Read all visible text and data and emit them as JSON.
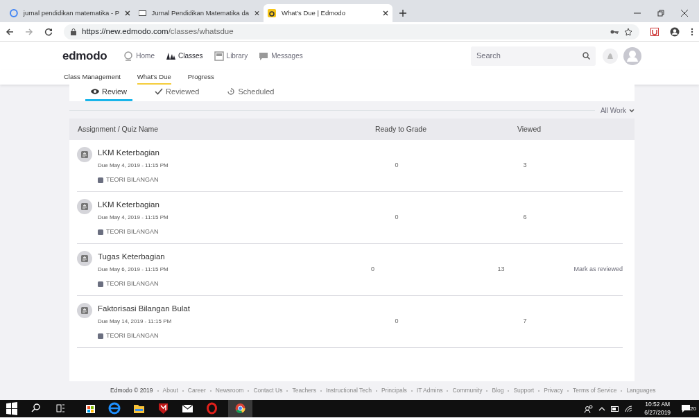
{
  "browser": {
    "tabs": [
      {
        "title": "jurnal pendidikan matematika - P",
        "selected": false
      },
      {
        "title": "Jurnal Pendidikan Matematika da",
        "selected": false
      },
      {
        "title": "What's Due | Edmodo",
        "selected": true
      }
    ],
    "url_host": "https://new.edmodo.com",
    "url_path": "/classes/whatsdue"
  },
  "nav": {
    "logo": "edmodo",
    "items": [
      {
        "label": "Home",
        "selected": false
      },
      {
        "label": "Classes",
        "selected": true
      },
      {
        "label": "Library",
        "selected": false
      },
      {
        "label": "Messages",
        "selected": false
      }
    ],
    "search_placeholder": "Search"
  },
  "subnav": [
    {
      "label": "Class Management",
      "selected": false
    },
    {
      "label": "What's Due",
      "selected": true
    },
    {
      "label": "Progress",
      "selected": false
    }
  ],
  "tabs": [
    {
      "label": "Review",
      "selected": true
    },
    {
      "label": "Reviewed",
      "selected": false
    },
    {
      "label": "Scheduled",
      "selected": false
    }
  ],
  "filter": "All Work",
  "table": {
    "columns": [
      "Assignment / Quiz Name",
      "Ready to Grade",
      "Viewed"
    ],
    "rows": [
      {
        "title": "LKM Keterbagian",
        "due": "Due May 4, 2019 - 11:15 PM",
        "tag": "TEORI BILANGAN",
        "ready": "0",
        "viewed": "3"
      },
      {
        "title": "LKM Keterbagian",
        "due": "Due May 4, 2019 - 11:15 PM",
        "tag": "TEORI BILANGAN",
        "ready": "0",
        "viewed": "6"
      },
      {
        "title": "Tugas Keterbagian",
        "due": "Due May 6, 2019 - 11:15 PM",
        "tag": "TEORI BILANGAN",
        "ready": "0",
        "viewed": "13",
        "action": "Mark as reviewed"
      },
      {
        "title": "Faktorisasi Bilangan Bulat",
        "due": "Due May 14, 2019 - 11:15 PM",
        "tag": "TEORI BILANGAN",
        "ready": "0",
        "viewed": "7"
      }
    ]
  },
  "footer": {
    "copyright": "Edmodo © 2019",
    "links": [
      "About",
      "Career",
      "Newsroom",
      "Contact Us",
      "Teachers",
      "Instructional Tech",
      "Principals",
      "IT Admins",
      "Community",
      "Blog",
      "Support",
      "Privacy",
      "Terms of Service",
      "Languages"
    ]
  },
  "taskbar": {
    "time": "10:52 AM",
    "date": "6/27/2019",
    "notifications": "20"
  }
}
